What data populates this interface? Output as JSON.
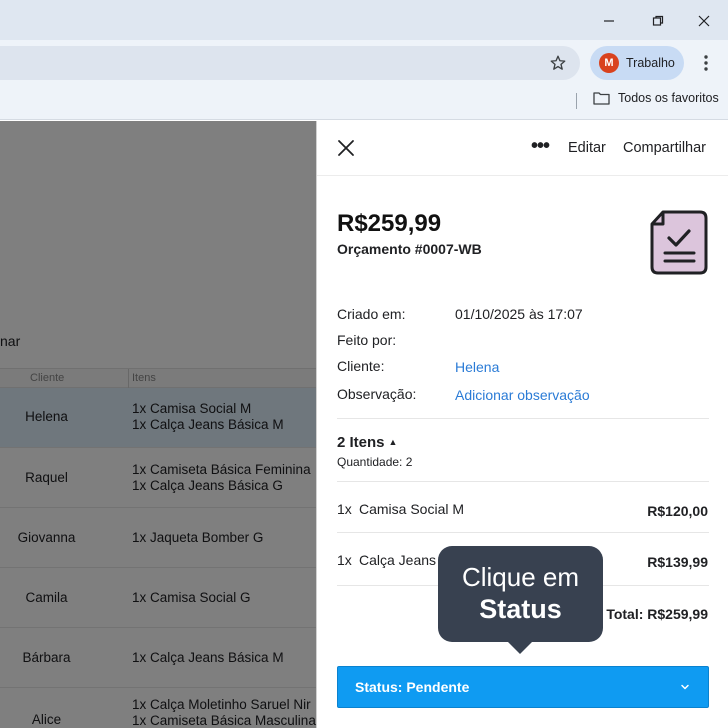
{
  "browser": {
    "profile_initial": "M",
    "profile_name": "Trabalho",
    "bookmarks_label": "Todos os favoritos"
  },
  "page": {
    "partial_heading": "nar",
    "columns": [
      "Cliente",
      "Itens"
    ],
    "rows": [
      {
        "client": "Helena",
        "items": [
          "1x Camisa Social M",
          "1x Calça Jeans Básica M"
        ],
        "selected": true
      },
      {
        "client": "Raquel",
        "items": [
          "1x Camiseta Básica Feminina",
          "1x Calça Jeans Básica G"
        ],
        "selected": false
      },
      {
        "client": "Giovanna",
        "items": [
          "1x Jaqueta Bomber G"
        ],
        "selected": false
      },
      {
        "client": "Camila",
        "items": [
          "1x Camisa Social G"
        ],
        "selected": false
      },
      {
        "client": "Bárbara",
        "items": [
          "1x Calça Jeans Básica M"
        ],
        "selected": false
      },
      {
        "client": "Alice",
        "items": [
          "1x Calça Moletinho Saruel Nir",
          "1x Camiseta Básica Masculina"
        ],
        "selected": false
      }
    ]
  },
  "panel": {
    "more_label": "•••",
    "edit_label": "Editar",
    "share_label": "Compartilhar",
    "amount": "R$259,99",
    "quote_number": "Orçamento #0007-WB",
    "info": {
      "created_label": "Criado em:",
      "created_value": "01/10/2025 às 17:07",
      "made_by_label": "Feito por:",
      "made_by_value": "",
      "client_label": "Cliente:",
      "client_value": "Helena",
      "note_label": "Observação:",
      "note_value": "Adicionar observação"
    },
    "items_title": "2 Itens",
    "items_quantity": "Quantidade: 2",
    "lines": [
      {
        "qty": "1x",
        "name": "Camisa Social M",
        "price": "R$120,00"
      },
      {
        "qty": "1x",
        "name": "Calça Jeans Básica M",
        "price": "R$139,99"
      }
    ],
    "total": "Total: R$259,99",
    "status_label": "Status: Pendente"
  },
  "tooltip": {
    "line1": "Clique em",
    "line2": "Status"
  },
  "colors": {
    "accent": "#0f9bf2",
    "link": "#2a7bd6",
    "tooltip_bg": "#384150",
    "avatar": "#d9421e"
  }
}
